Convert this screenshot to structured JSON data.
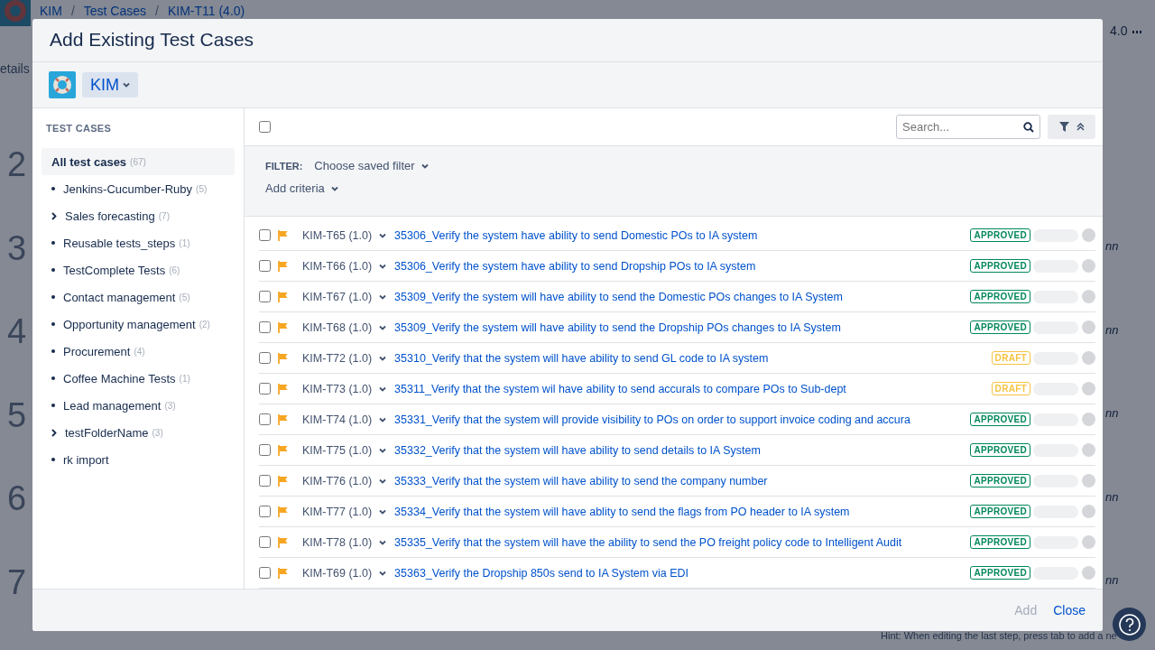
{
  "background_page": {
    "breadcrumb": [
      "KIM",
      "Test Cases",
      "KIM-T11 (4.0)"
    ],
    "breadcrumb_separator": "/",
    "side_label": "etails",
    "version": "4.0",
    "step_numbers": [
      "2",
      "3",
      "4",
      "5",
      "6",
      "7"
    ],
    "step_notes": [
      "nn",
      "nn",
      "nn",
      "nn",
      "nn"
    ],
    "hint": "Hint: When editing the last step, press tab to add a ne"
  },
  "dialog": {
    "title": "Add Existing Test Cases",
    "project": {
      "label": "KIM"
    },
    "sidebar": {
      "heading": "TEST CASES",
      "items": [
        {
          "label": "All test cases",
          "count": "(67)",
          "kind": "root",
          "selected": true
        },
        {
          "label": "Jenkins-Cucumber-Ruby",
          "count": "(5)",
          "kind": "leaf",
          "selected": false
        },
        {
          "label": "Sales forecasting",
          "count": "(7)",
          "kind": "folder",
          "selected": false
        },
        {
          "label": "Reusable tests_steps",
          "count": "(1)",
          "kind": "leaf",
          "selected": false
        },
        {
          "label": "TestComplete Tests",
          "count": "(6)",
          "kind": "leaf",
          "selected": false
        },
        {
          "label": "Contact management",
          "count": "(5)",
          "kind": "leaf",
          "selected": false
        },
        {
          "label": "Opportunity management",
          "count": "(2)",
          "kind": "leaf",
          "selected": false
        },
        {
          "label": "Procurement",
          "count": "(4)",
          "kind": "leaf",
          "selected": false
        },
        {
          "label": "Coffee Machine Tests",
          "count": "(1)",
          "kind": "leaf",
          "selected": false
        },
        {
          "label": "Lead management",
          "count": "(3)",
          "kind": "leaf",
          "selected": false
        },
        {
          "label": "testFolderName",
          "count": "(3)",
          "kind": "folder",
          "selected": false
        },
        {
          "label": "rk import",
          "kind": "leaf",
          "selected": false
        }
      ]
    },
    "select_all": {
      "checked": false
    },
    "search": {
      "placeholder": "Search..."
    },
    "filter": {
      "label": "FILTER:",
      "saved_filter": "Choose saved filter",
      "add_criteria": "Add criteria"
    },
    "rows": [
      {
        "key": "KIM-T65 (1.0)",
        "title": "35306_Verify the system have ability to send Domestic POs to IA system",
        "status": "APPROVED",
        "checked": false
      },
      {
        "key": "KIM-T66 (1.0)",
        "title": "35306_Verify the system have ability to send Dropship POs to IA system",
        "status": "APPROVED",
        "checked": false
      },
      {
        "key": "KIM-T67 (1.0)",
        "title": "35309_Verify the system will have ability to send the Domestic POs changes to IA System",
        "status": "APPROVED",
        "checked": false
      },
      {
        "key": "KIM-T68 (1.0)",
        "title": "35309_Verify the system will have ability to send the Dropship POs changes to IA System",
        "status": "APPROVED",
        "checked": false
      },
      {
        "key": "KIM-T72 (1.0)",
        "title": "35310_Verify that the system will have ability to send GL code to IA system",
        "status": "DRAFT",
        "checked": false
      },
      {
        "key": "KIM-T73 (1.0)",
        "title": "35311_Verify that the system wil have ability to send accurals to compare POs to Sub-dept",
        "status": "DRAFT",
        "checked": false
      },
      {
        "key": "KIM-T74 (1.0)",
        "title": "35331_Verify that the system will provide visibility to POs on order to support invoice coding and accura",
        "status": "APPROVED",
        "checked": false
      },
      {
        "key": "KIM-T75 (1.0)",
        "title": "35332_Verify that the system will have ability to send details to IA System",
        "status": "APPROVED",
        "checked": false
      },
      {
        "key": "KIM-T76 (1.0)",
        "title": "35333_Verify that the system will have ability to send the company number",
        "status": "APPROVED",
        "checked": false
      },
      {
        "key": "KIM-T77 (1.0)",
        "title": "35334_Verify that the system will have ablity to send the flags from PO header to IA system",
        "status": "APPROVED",
        "checked": false
      },
      {
        "key": "KIM-T78 (1.0)",
        "title": "35335_Verify that the system will have the ability to send the PO freight policy code to Intelligent Audit",
        "status": "APPROVED",
        "checked": false
      },
      {
        "key": "KIM-T69 (1.0)",
        "title": "35363_Verify the Dropship 850s send to IA System via EDI",
        "status": "APPROVED",
        "checked": false
      }
    ],
    "footer": {
      "buttons": [
        {
          "label": "Add",
          "disabled": true
        },
        {
          "label": "Close",
          "disabled": false
        }
      ]
    }
  }
}
